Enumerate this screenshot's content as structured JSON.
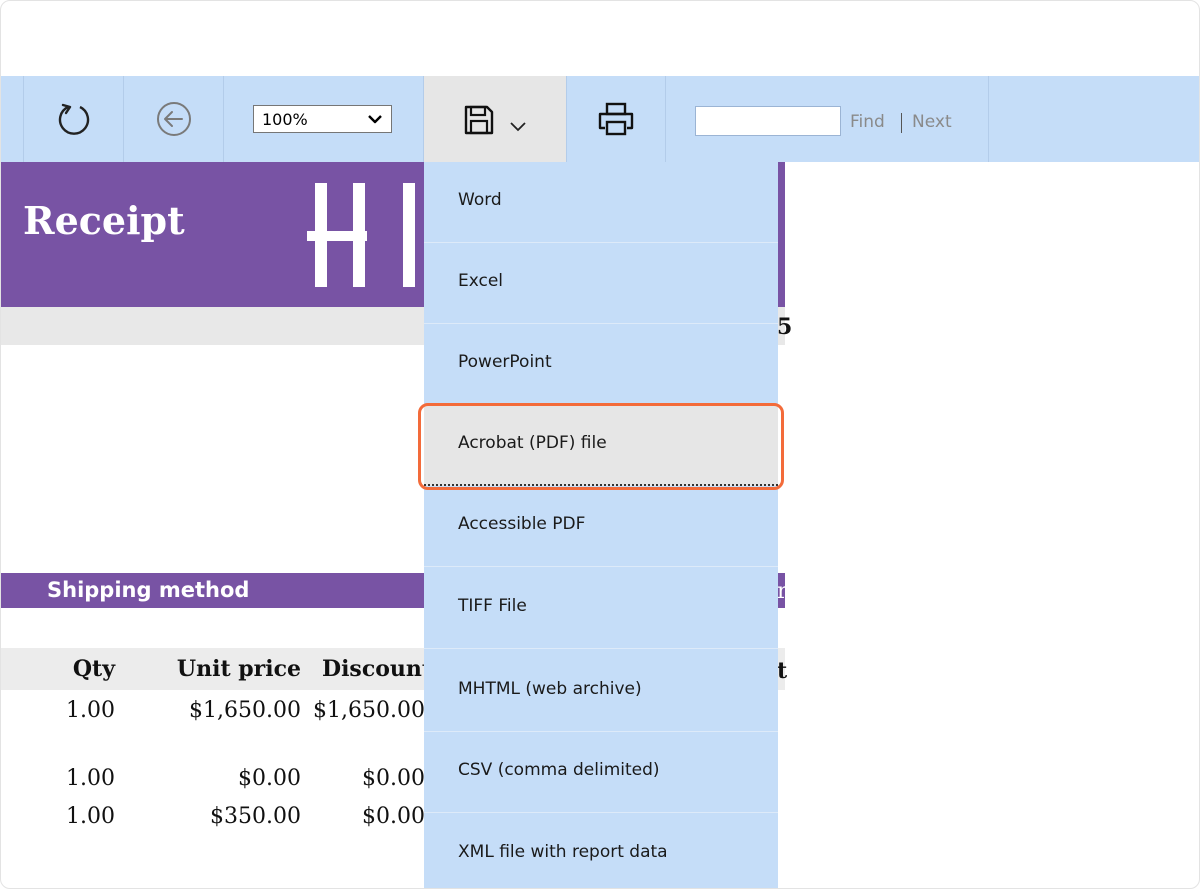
{
  "toolbar": {
    "refresh_icon": "refresh-icon",
    "back_icon": "back-arrow-icon",
    "zoom_value": "100%",
    "export_icon": "save-disk-icon",
    "print_icon": "printer-icon",
    "find_input_value": "",
    "find_label": "Find",
    "next_label": "Next"
  },
  "report": {
    "title": "Receipt",
    "shipping_header": "Shipping method",
    "columns": [
      "Qty",
      "Unit price",
      "Discount"
    ],
    "rows": [
      {
        "qty": "1.00",
        "unit_price": "$1,650.00",
        "discount": "$1,650.00"
      },
      {
        "qty": "1.00",
        "unit_price": "$0.00",
        "discount": "$0.00"
      },
      {
        "qty": "1.00",
        "unit_price": "$350.00",
        "discount": "$0.00"
      }
    ]
  },
  "export_menu": {
    "items": [
      {
        "label": "Word"
      },
      {
        "label": "Excel"
      },
      {
        "label": "PowerPoint"
      },
      {
        "label": "Acrobat (PDF) file",
        "selected": true
      },
      {
        "label": "Accessible PDF"
      },
      {
        "label": "TIFF File"
      },
      {
        "label": "MHTML (web archive)"
      },
      {
        "label": "CSV (comma delimited)"
      },
      {
        "label": "XML file with report data"
      }
    ]
  },
  "colors": {
    "toolbar_bg": "#c5ddf8",
    "report_accent": "#7853a4",
    "highlight_outline": "#f36b3a"
  }
}
